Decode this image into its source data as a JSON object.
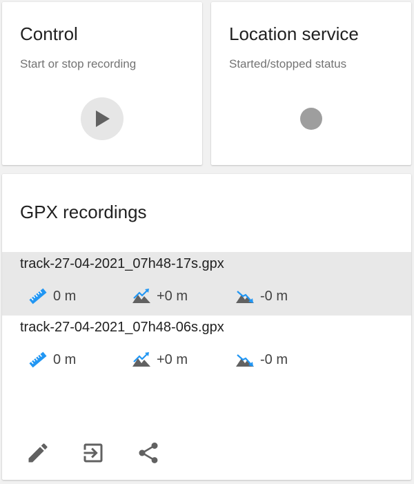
{
  "control": {
    "title": "Control",
    "subtitle": "Start or stop recording",
    "play_icon": "play-icon"
  },
  "location": {
    "title": "Location service",
    "subtitle": "Started/stopped status",
    "status_icon": "status-dot-icon",
    "status_color": "#9e9e9e"
  },
  "gpx": {
    "title": "GPX recordings",
    "tracks": [
      {
        "name": "track-27-04-2021_07h48-17s.gpx",
        "distance": "0 m",
        "elevation_gain": "+0 m",
        "elevation_loss": "-0 m",
        "selected": true
      },
      {
        "name": "track-27-04-2021_07h48-06s.gpx",
        "distance": "0 m",
        "elevation_gain": "+0 m",
        "elevation_loss": "-0 m",
        "selected": false
      }
    ],
    "actions": [
      "edit-icon",
      "export-icon",
      "share-icon"
    ]
  },
  "colors": {
    "accent_blue": "#2196f3",
    "icon_gray": "#616161",
    "selected_row": "#e8e8e8",
    "background": "#f1f1f1"
  }
}
